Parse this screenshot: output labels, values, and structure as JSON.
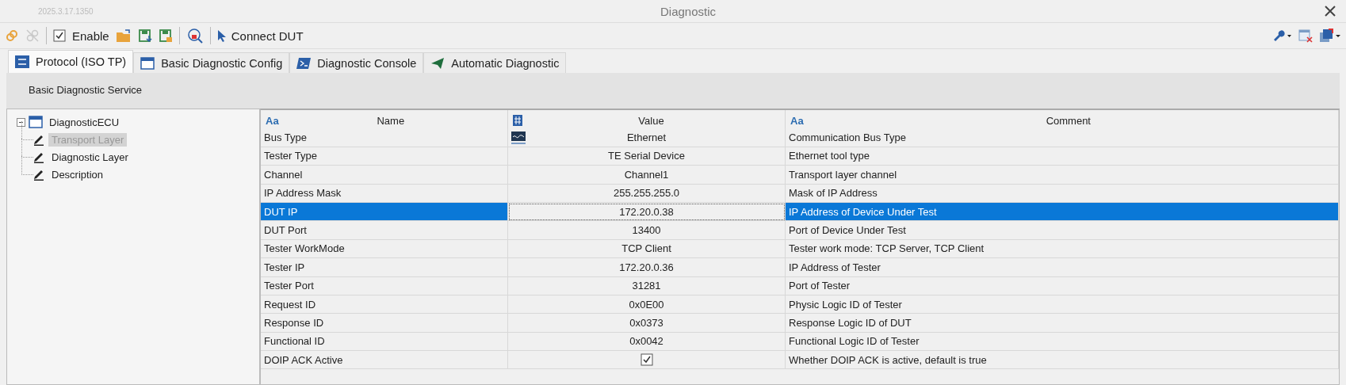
{
  "window": {
    "version": "2025.3.17.1350",
    "title": "Diagnostic"
  },
  "toolbar": {
    "enable": {
      "label": "Enable",
      "checked": true
    },
    "connect": {
      "label": "Connect DUT"
    }
  },
  "tabs": [
    {
      "label": "Protocol (ISO TP)",
      "selected": true
    },
    {
      "label": "Basic Diagnostic Config",
      "selected": false
    },
    {
      "label": "Diagnostic Console",
      "selected": false
    },
    {
      "label": "Automatic Diagnostic",
      "selected": false
    }
  ],
  "section": {
    "title": "Basic Diagnostic Service"
  },
  "tree": {
    "label": "DiagnosticECU",
    "expanded": true,
    "children": [
      {
        "label": "Transport Layer",
        "selected": true
      },
      {
        "label": "Diagnostic Layer",
        "selected": false
      },
      {
        "label": "Description",
        "selected": false
      }
    ]
  },
  "table": {
    "columns": [
      {
        "label": "Name",
        "kind": "text",
        "marker": "Aa"
      },
      {
        "label": "Value",
        "kind": "number"
      },
      {
        "label": "Comment",
        "kind": "text",
        "marker": "Aa"
      }
    ],
    "rows": [
      {
        "name": "Bus Type",
        "kind": "icon_text",
        "value": "Ethernet",
        "comment": "Communication Bus Type",
        "selected": false
      },
      {
        "name": "Tester Type",
        "kind": "text",
        "value": "TE Serial Device",
        "comment": "Ethernet tool type",
        "selected": false
      },
      {
        "name": "Channel",
        "kind": "text",
        "value": "Channel1",
        "comment": "Transport layer channel",
        "selected": false
      },
      {
        "name": "IP Address Mask",
        "kind": "text",
        "value": "255.255.255.0",
        "comment": "Mask of IP Address",
        "selected": false
      },
      {
        "name": "DUT IP",
        "kind": "text",
        "value": "172.20.0.38",
        "comment": "IP Address of Device Under Test",
        "selected": true
      },
      {
        "name": "DUT Port",
        "kind": "text",
        "value": "13400",
        "comment": "Port of Device Under Test",
        "selected": false
      },
      {
        "name": "Tester WorkMode",
        "kind": "text",
        "value": "TCP Client",
        "comment": "Tester work mode: TCP Server, TCP Client",
        "selected": false
      },
      {
        "name": "Tester IP",
        "kind": "text",
        "value": "172.20.0.36",
        "comment": "IP Address of Tester",
        "selected": false
      },
      {
        "name": "Tester Port",
        "kind": "text",
        "value": "31281",
        "comment": "Port of Tester",
        "selected": false
      },
      {
        "name": "Request ID",
        "kind": "text",
        "value": "0x0E00",
        "comment": "Physic Logic ID of Tester",
        "selected": false
      },
      {
        "name": "Response ID",
        "kind": "text",
        "value": "0x0373",
        "comment": "Response Logic ID of DUT",
        "selected": false
      },
      {
        "name": "Functional ID",
        "kind": "text",
        "value": "0x0042",
        "comment": "Functional Logic ID of Tester",
        "selected": false
      },
      {
        "name": "DOIP ACK Active",
        "kind": "checkbox",
        "checked": true,
        "comment": "Whether DOIP ACK is active, default is true",
        "selected": false
      }
    ]
  }
}
